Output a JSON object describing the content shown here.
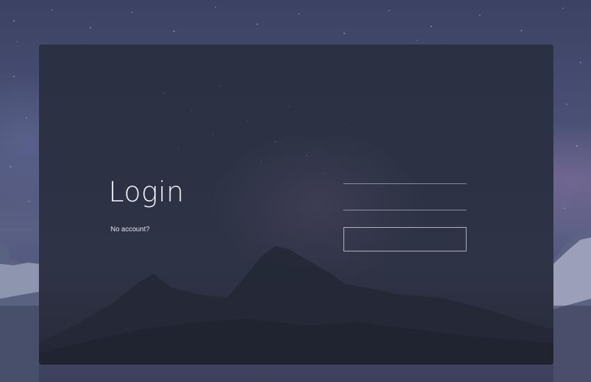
{
  "login": {
    "title": "Login",
    "no_account_link": "No account?",
    "username": {
      "value": "",
      "placeholder": ""
    },
    "password": {
      "value": "",
      "placeholder": ""
    },
    "submit_label": ""
  }
}
